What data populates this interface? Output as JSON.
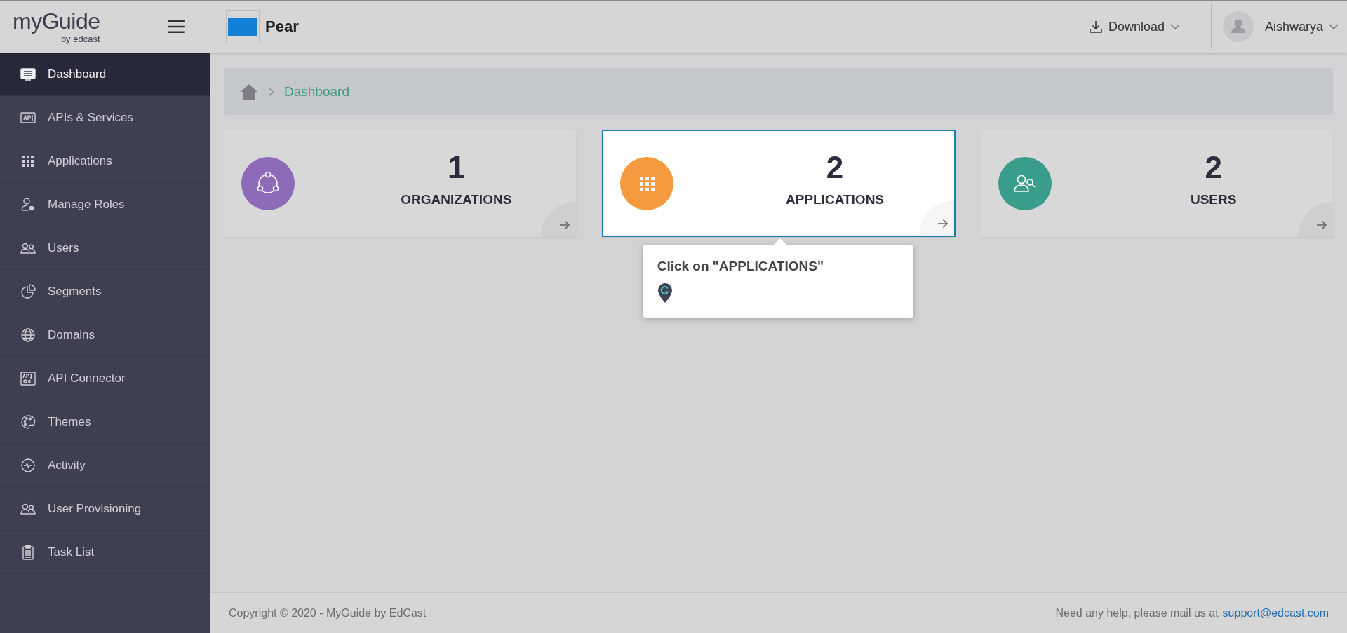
{
  "header": {
    "logo": {
      "name": "myGuide",
      "tagline": "by edcast"
    },
    "app_name": "Pear",
    "download": "Download",
    "user": "Aishwarya"
  },
  "sidebar": {
    "items": [
      {
        "label": "Dashboard",
        "selected": true
      },
      {
        "label": "APIs & Services",
        "selected": false
      },
      {
        "label": "Applications",
        "selected": false
      },
      {
        "label": "Manage Roles",
        "selected": false
      },
      {
        "label": "Users",
        "selected": false
      },
      {
        "label": "Segments",
        "selected": false
      },
      {
        "label": "Domains",
        "selected": false
      },
      {
        "label": "API Connector",
        "selected": false
      },
      {
        "label": "Themes",
        "selected": false
      },
      {
        "label": "Activity",
        "selected": false
      },
      {
        "label": "User Provisioning",
        "selected": false
      },
      {
        "label": "Task List",
        "selected": false
      }
    ]
  },
  "breadcrumb": {
    "current": "Dashboard"
  },
  "cards": [
    {
      "count": "1",
      "label": "ORGANIZATIONS",
      "color": "#8e6bb8",
      "highlighted": false
    },
    {
      "count": "2",
      "label": "APPLICATIONS",
      "color": "#f59a3f",
      "highlighted": true
    },
    {
      "count": "2",
      "label": "USERS",
      "color": "#3a9c8a",
      "highlighted": false
    }
  ],
  "tooltip": {
    "text": "Click on \"APPLICATIONS\""
  },
  "footer": {
    "copyright": "Copyright © 2020 - MyGuide by EdCast",
    "help": "Need any help, please mail us at",
    "email": "support@edcast.com"
  }
}
